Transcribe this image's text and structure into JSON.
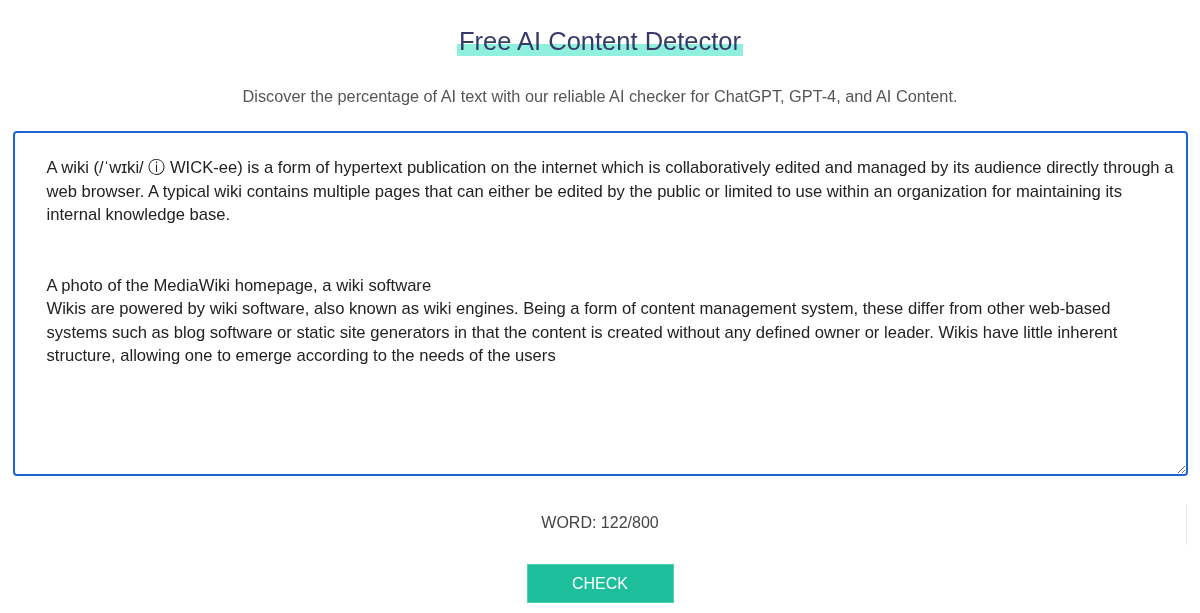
{
  "header": {
    "title": "Free AI Content Detector",
    "subtitle": "Discover the percentage of AI text with our reliable AI checker for ChatGPT, GPT-4, and AI Content."
  },
  "editor": {
    "value": "A wiki (/ˈwɪki/ ⓘ WICK-ee) is a form of hypertext publication on the internet which is collaboratively edited and managed by its audience directly through a web browser. A typical wiki contains multiple pages that can either be edited by the public or limited to use within an organization for maintaining its internal knowledge base.\n\n\nA photo of the MediaWiki homepage, a wiki software\nWikis are powered by wiki software, also known as wiki engines. Being a form of content management system, these differ from other web-based systems such as blog software or static site generators in that the content is created without any defined owner or leader. Wikis have little inherent structure, allowing one to emerge according to the needs of the users",
    "focused": true
  },
  "word_count": "WORD: 122/800",
  "check_button": "CHECK"
}
